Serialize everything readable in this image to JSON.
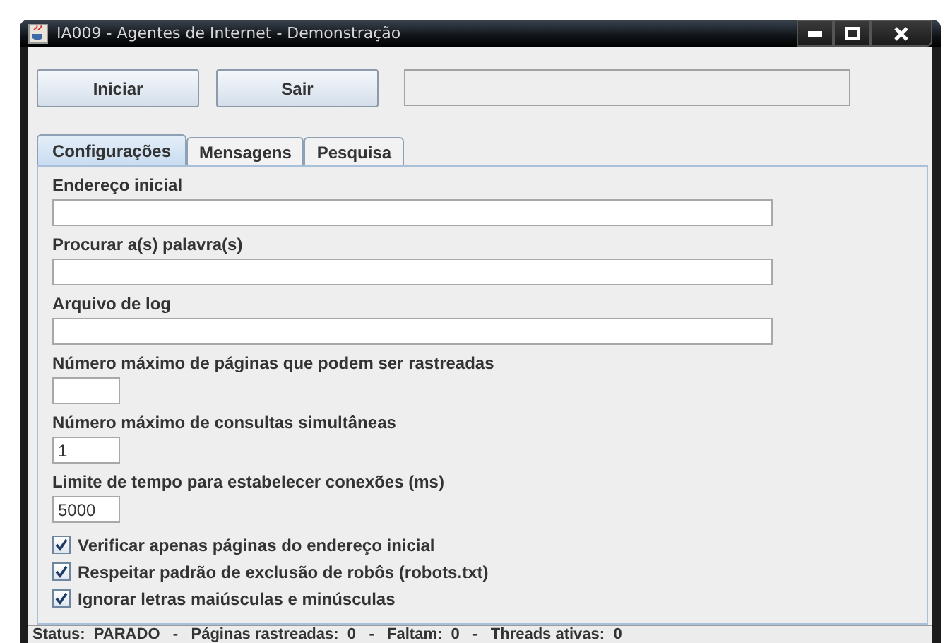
{
  "window": {
    "title": "IA009 - Agentes de Internet - Demonstração"
  },
  "buttons": [
    {
      "label": "Iniciar"
    },
    {
      "label": "Sair"
    }
  ],
  "message_field": {
    "kind": "empty"
  },
  "tabs": [
    {
      "label": "Configurações",
      "selected": true
    },
    {
      "label": "Mensagens",
      "selected": false
    },
    {
      "label": "Pesquisa",
      "selected": false
    }
  ],
  "fields": [
    {
      "label": "Endereço inicial",
      "kind": "wide"
    },
    {
      "label": "Procurar a(s) palavra(s)",
      "kind": "wide"
    },
    {
      "label": "Arquivo de log",
      "kind": "wide"
    },
    {
      "label": "Número máximo de páginas que podem ser rastreadas",
      "kind": "short"
    },
    {
      "label": "Número máximo de consultas simultâneas",
      "value": "1",
      "kind": "short"
    },
    {
      "label": "Limite de tempo para estabelecer conexões (ms)",
      "value": "5000",
      "kind": "short"
    }
  ],
  "options": [
    {
      "label": "Verificar apenas páginas do endereço inicial",
      "checked": true
    },
    {
      "label": "Respeitar padrão de exclusão de robôs (robots.txt)",
      "checked": true
    },
    {
      "label": "Ignorar letras maiúsculas e minúsculas",
      "checked": true
    }
  ],
  "status_bar": "Status:  PARADO   -   Páginas rastreadas:  0   -   Faltam:  0   -   Threads ativas:  0"
}
